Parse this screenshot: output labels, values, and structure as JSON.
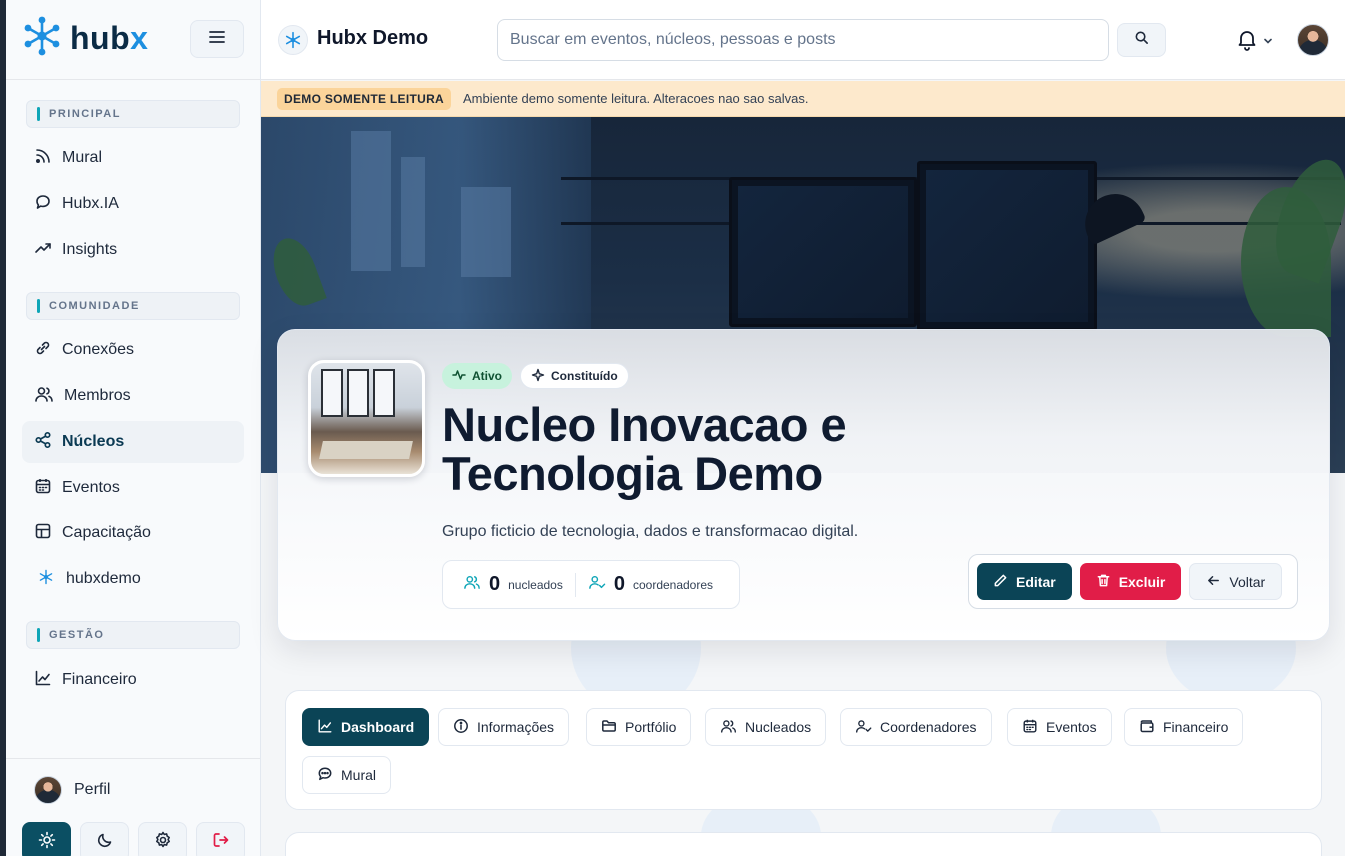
{
  "brand": {
    "name": "hub",
    "name_accent": "x"
  },
  "sidebar": {
    "sections": [
      {
        "label": "PRINCIPAL"
      },
      {
        "label": "COMUNIDADE"
      },
      {
        "label": "GESTÃO"
      }
    ],
    "items": [
      {
        "label": "Mural",
        "icon": "rss-icon"
      },
      {
        "label": "Hubx.IA",
        "icon": "chat-bubble-icon"
      },
      {
        "label": "Insights",
        "icon": "trending-up-icon"
      },
      {
        "label": "Conexões",
        "icon": "link-icon"
      },
      {
        "label": "Membros",
        "icon": "users-icon"
      },
      {
        "label": "Núcleos",
        "icon": "share-nodes-icon",
        "active": true
      },
      {
        "label": "Eventos",
        "icon": "calendar-icon"
      },
      {
        "label": "Capacitação",
        "icon": "grid-icon"
      },
      {
        "label": "hubxdemo",
        "icon": "snowflake-icon"
      },
      {
        "label": "Financeiro",
        "icon": "line-chart-icon"
      }
    ],
    "profile_label": "Perfil"
  },
  "topbar": {
    "workspace": "Hubx Demo",
    "search_placeholder": "Buscar em eventos, núcleos, pessoas e posts"
  },
  "banner": {
    "badge": "DEMO SOMENTE LEITURA",
    "text": "Ambiente demo somente leitura. Alteracoes nao sao salvas."
  },
  "nucleo": {
    "status_badge": "Ativo",
    "type_badge": "Constituído",
    "title": "Nucleo Inovacao e Tecnologia Demo",
    "description": "Grupo ficticio de tecnologia, dados e transformacao digital.",
    "stats": [
      {
        "value": "0",
        "label": "nucleados"
      },
      {
        "value": "0",
        "label": "coordenadores"
      }
    ],
    "actions": {
      "edit": "Editar",
      "delete": "Excluir",
      "back": "Voltar"
    }
  },
  "tabs": [
    {
      "label": "Dashboard",
      "active": true
    },
    {
      "label": "Informações"
    },
    {
      "label": "Portfólio"
    },
    {
      "label": "Nucleados"
    },
    {
      "label": "Coordenadores"
    },
    {
      "label": "Eventos"
    },
    {
      "label": "Financeiro"
    },
    {
      "label": "Mural"
    }
  ],
  "colors": {
    "primary": "#0b4456",
    "accent": "#1d8fe0",
    "danger": "#e11d48",
    "active_badge": "#c7f2dd",
    "demo_banner": "#fde9cc"
  }
}
